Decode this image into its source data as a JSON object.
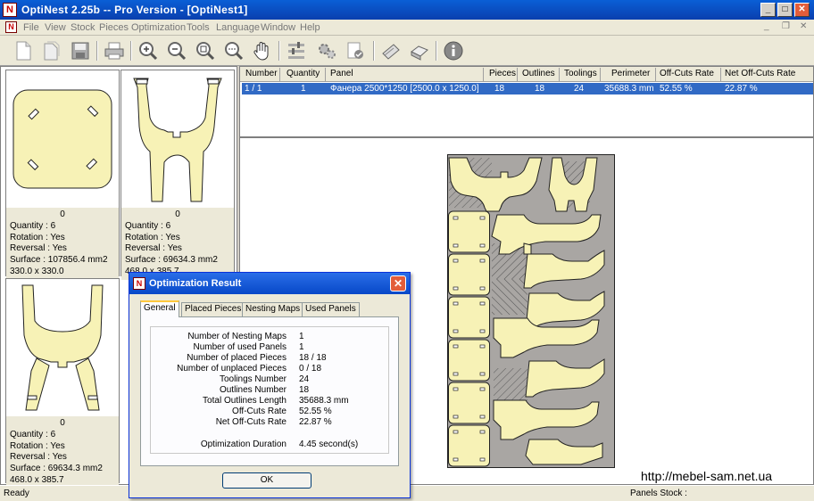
{
  "app": {
    "title": "OptiNest 2.25b -- Pro Version - [OptiNest1]",
    "logo_letter": "N",
    "win_min": "_",
    "win_max": "□",
    "win_close": "✕"
  },
  "menu": {
    "items": [
      "File",
      "View",
      "Stock",
      "Pieces",
      "Optimization",
      "Tools",
      "Language",
      "Window",
      "Help"
    ],
    "mdi_min": "_",
    "mdi_restore": "❐",
    "mdi_close": "✕"
  },
  "toolbar": {
    "icons": [
      "new-icon",
      "open-icon",
      "save-icon",
      "print-icon",
      "zoom-in-icon",
      "zoom-out-icon",
      "zoom-fit-icon",
      "zoom-window-icon",
      "pan-hand-icon",
      "parameters-icon",
      "optimize-icon",
      "validate-icon",
      "report-icon",
      "export-icon",
      "info-icon"
    ]
  },
  "pieces": [
    {
      "count": "0",
      "quantity": "Quantity : 6",
      "rotation": "Rotation : Yes",
      "reversal": "Reversal : Yes",
      "surface": "Surface : 107856.4 mm2",
      "size": "330.0  x  330.0",
      "shape": "square"
    },
    {
      "count": "0",
      "quantity": "Quantity : 6",
      "rotation": "Rotation : Yes",
      "reversal": "Reversal : Yes",
      "surface": "Surface : 69634.3 mm2",
      "size": "468.0  x  385.7",
      "shape": "frame"
    },
    {
      "count": "0",
      "quantity": "Quantity : 6",
      "rotation": "Rotation : Yes",
      "reversal": "Reversal : Yes",
      "surface": "Surface : 69634.3 mm2",
      "size": "468.0  x  385.7",
      "shape": "frame"
    }
  ],
  "table": {
    "headers": [
      "Number",
      "Quantity",
      "Panel",
      "Pieces",
      "Outlines",
      "Toolings",
      "Perimeter",
      "Off-Cuts Rate",
      "Net Off-Cuts Rate"
    ],
    "rows": [
      [
        "1 / 1",
        "1",
        "Фанера 2500*1250 [2500.0  x  1250.0]",
        "18",
        "18",
        "24",
        "35688.3 mm",
        "52.55 %",
        "22.87 %"
      ]
    ]
  },
  "dialog": {
    "title": "Optimization Result",
    "tabs": [
      "General",
      "Placed Pieces",
      "Nesting Maps",
      "Used Panels"
    ],
    "active_tab": "General",
    "fields": [
      {
        "label": "Number of Nesting Maps",
        "value": "1"
      },
      {
        "label": "Number of used Panels",
        "value": "1"
      },
      {
        "label": "Number of placed Pieces",
        "value": "18 / 18"
      },
      {
        "label": "Number of unplaced Pieces",
        "value": "0 / 18"
      },
      {
        "label": "Toolings Number",
        "value": "24"
      },
      {
        "label": "Outlines Number",
        "value": "18"
      },
      {
        "label": "Total Outlines Length",
        "value": "35688.3 mm"
      },
      {
        "label": "Off-Cuts Rate",
        "value": "52.55 %"
      },
      {
        "label": "Net Off-Cuts Rate",
        "value": "22.87 %"
      }
    ],
    "duration_label": "Optimization Duration",
    "duration_value": "4.45 second(s)",
    "ok_label": "OK",
    "close_glyph": "✕"
  },
  "status": {
    "left": "Ready",
    "right": "Panels Stock :"
  },
  "watermark": "http://mebel-sam.net.ua",
  "colors": {
    "piece_fill": "#f7f2b6",
    "piece_stroke": "#222222",
    "sheet_bg": "#a9a6a3",
    "selection": "#316ac5",
    "titlebar": "#0a4fc6"
  }
}
